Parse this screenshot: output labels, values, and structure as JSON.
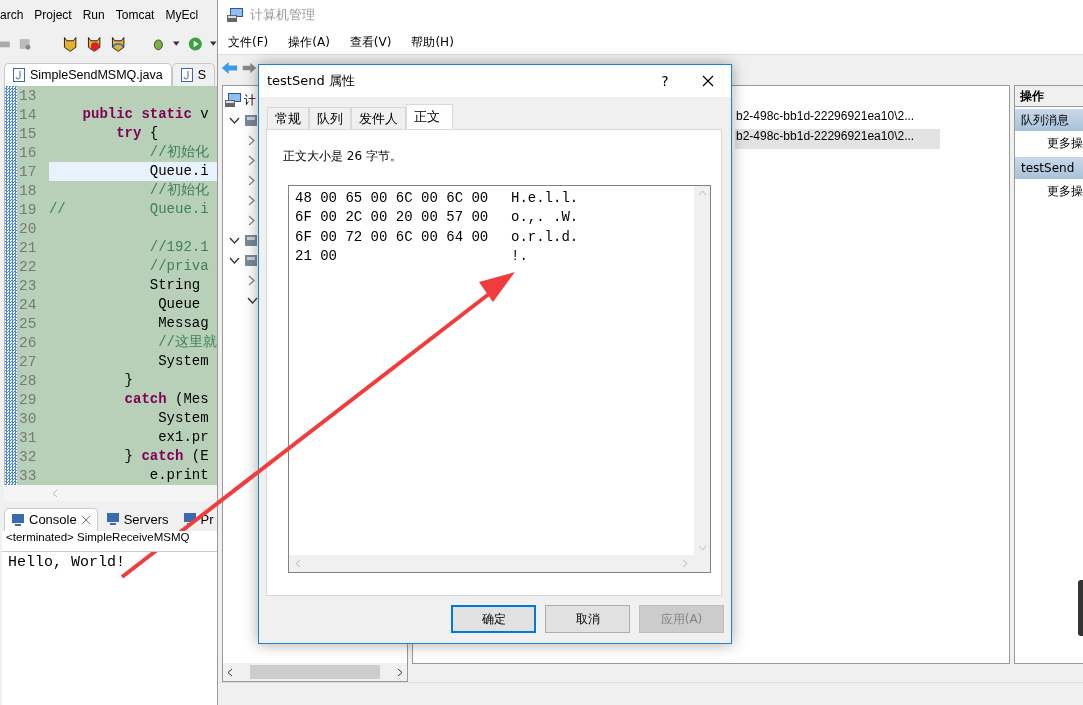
{
  "eclipse": {
    "menu": [
      "arch",
      "Project",
      "Run",
      "Tomcat",
      "MyEcl"
    ],
    "editor_tabs": [
      {
        "label": "SimpleSendMSMQ.java",
        "selected": true
      },
      {
        "label": "S",
        "selected": false
      }
    ],
    "code_lines": [
      {
        "number": "13",
        "current": false
      },
      {
        "number": "14",
        "current": false,
        "segments": [
          {
            "kind": "keyword",
            "text": "    public static"
          },
          {
            "kind": "plain",
            "text": " v"
          }
        ]
      },
      {
        "number": "15",
        "current": false,
        "segments": [
          {
            "kind": "keyword",
            "text": "        try"
          },
          {
            "kind": "plain",
            "text": " {"
          }
        ]
      },
      {
        "number": "16",
        "current": false,
        "segments": [
          {
            "kind": "comment",
            "text": "            //初始化"
          }
        ]
      },
      {
        "number": "17",
        "current": true,
        "segments": [
          {
            "kind": "plain",
            "text": "            Queue.i"
          }
        ]
      },
      {
        "number": "18",
        "current": false,
        "segments": [
          {
            "kind": "comment",
            "text": "            //初始化"
          }
        ]
      },
      {
        "number": "19",
        "current": false,
        "segments": [
          {
            "kind": "comment",
            "text": "//          Queue.i"
          }
        ]
      },
      {
        "number": "20",
        "current": false
      },
      {
        "number": "21",
        "current": false,
        "segments": [
          {
            "kind": "comment",
            "text": "            //192.1"
          }
        ]
      },
      {
        "number": "22",
        "current": false,
        "segments": [
          {
            "kind": "comment",
            "text": "            //priva"
          }
        ]
      },
      {
        "number": "23",
        "current": false,
        "segments": [
          {
            "kind": "plain",
            "text": "            String"
          }
        ]
      },
      {
        "number": "24",
        "current": false,
        "segments": [
          {
            "kind": "plain",
            "text": "             Queue"
          }
        ]
      },
      {
        "number": "25",
        "current": false,
        "segments": [
          {
            "kind": "plain",
            "text": "             Messag"
          }
        ]
      },
      {
        "number": "26",
        "current": false,
        "segments": [
          {
            "kind": "comment",
            "text": "             //这里就"
          }
        ]
      },
      {
        "number": "27",
        "current": false,
        "segments": [
          {
            "kind": "plain",
            "text": "             System"
          }
        ]
      },
      {
        "number": "28",
        "current": false,
        "segments": [
          {
            "kind": "plain",
            "text": "         }"
          }
        ]
      },
      {
        "number": "29",
        "current": false,
        "segments": [
          {
            "kind": "keyword",
            "text": "         catch"
          },
          {
            "kind": "plain",
            "text": " (Mes"
          }
        ]
      },
      {
        "number": "30",
        "current": false,
        "segments": [
          {
            "kind": "plain",
            "text": "             System"
          }
        ]
      },
      {
        "number": "31",
        "current": false,
        "segments": [
          {
            "kind": "plain",
            "text": "             ex1.pr"
          }
        ]
      },
      {
        "number": "32",
        "current": false,
        "segments": [
          {
            "kind": "plain",
            "text": "         } "
          },
          {
            "kind": "keyword",
            "text": "catch"
          },
          {
            "kind": "plain",
            "text": " (E"
          }
        ]
      },
      {
        "number": "33",
        "current": false,
        "segments": [
          {
            "kind": "plain",
            "text": "            e.print"
          }
        ]
      }
    ],
    "console_tabs": [
      {
        "label": "Console",
        "selected": true
      },
      {
        "label": "Servers",
        "selected": false
      },
      {
        "label": "Pr",
        "selected": false
      }
    ],
    "console_header": "<terminated> SimpleReceiveMSMQ",
    "console_output": "Hello, World!"
  },
  "mmc": {
    "window": {
      "title": "计算机管理"
    },
    "menu": [
      "文件(F)",
      "操作(A)",
      "查看(V)",
      "帮助(H)"
    ],
    "tree": {
      "root": "计",
      "children": [
        {
          "expanded": true,
          "children": [
            {
              "expanded": false
            },
            {
              "expanded": false
            },
            {
              "expanded": false
            },
            {
              "expanded": false
            },
            {
              "expanded": false
            }
          ]
        },
        {
          "expanded": true
        },
        {
          "expanded": true,
          "children": [
            {
              "expanded": false
            },
            {
              "expanded": true
            }
          ]
        }
      ]
    },
    "list_rows": [
      {
        "text": "b2-498c-bb1d-22296921ea10\\2...",
        "selected": false
      },
      {
        "text": "b2-498c-bb1d-22296921ea10\\2...",
        "selected": true
      }
    ],
    "actions": {
      "header": "操作",
      "sections": [
        {
          "title": "队列消息",
          "items": [
            "更多操"
          ]
        },
        {
          "title": "testSend",
          "items": [
            "更多操"
          ]
        }
      ]
    }
  },
  "dialog": {
    "title": "testSend 属性",
    "help": "?",
    "tabs": [
      {
        "label": "常规",
        "selected": false
      },
      {
        "label": "队列",
        "selected": false
      },
      {
        "label": "发件人",
        "selected": false
      },
      {
        "label": "正文",
        "selected": true
      }
    ],
    "size_text": "正文大小是 26 字节。",
    "hex_rows": [
      {
        "hex": "48 00 65 00 6C 00 6C 00",
        "text": "H.e.l.l."
      },
      {
        "hex": "6F 00 2C 00 20 00 57 00",
        "text": "o.,. .W."
      },
      {
        "hex": "6F 00 72 00 6C 00 64 00",
        "text": "o.r.l.d."
      },
      {
        "hex": "21 00",
        "text": "!."
      }
    ],
    "buttons": [
      {
        "label": "确定",
        "default": true,
        "disabled": false
      },
      {
        "label": "取消",
        "default": false,
        "disabled": false
      },
      {
        "label": "应用(A)",
        "default": false,
        "disabled": true
      }
    ]
  }
}
